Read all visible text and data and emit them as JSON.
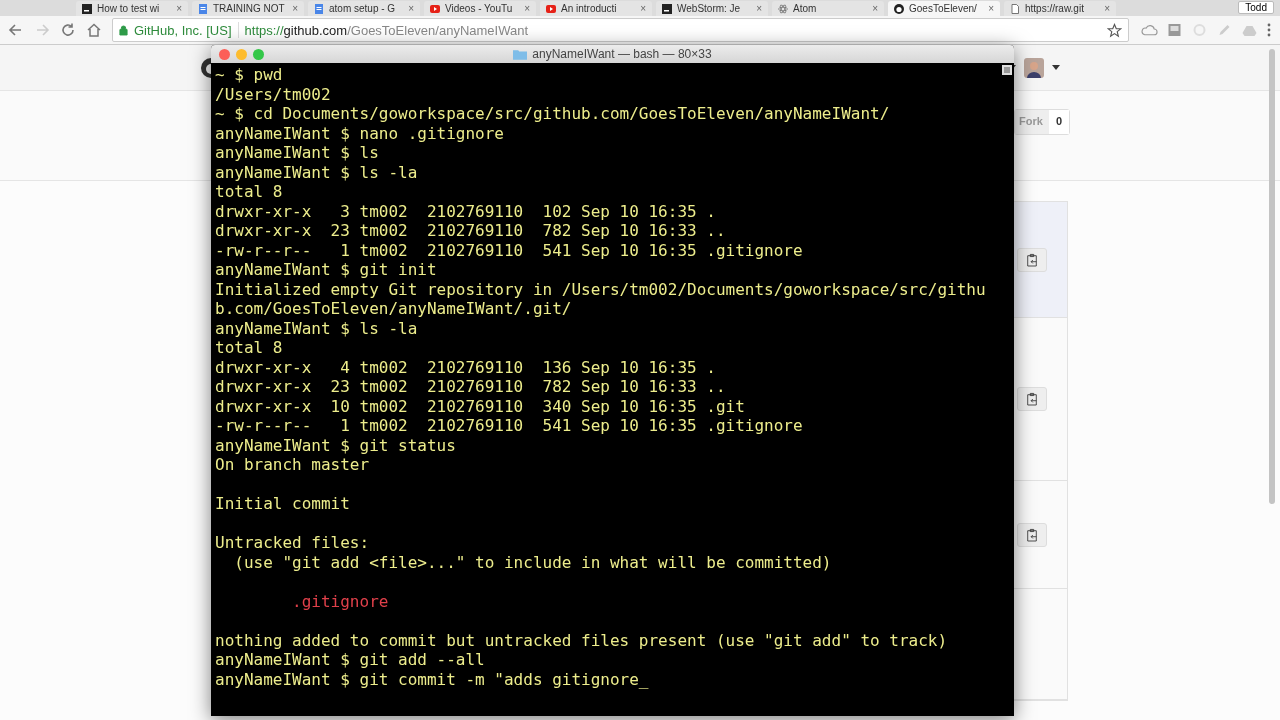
{
  "browser": {
    "tabs": [
      {
        "title": "How to test wi",
        "kind": "logo",
        "close": "×",
        "selected": false
      },
      {
        "title": "TRAINING NOT",
        "kind": "doc",
        "close": "×",
        "selected": false
      },
      {
        "title": "atom setup - G",
        "kind": "doc",
        "close": "×",
        "selected": false
      },
      {
        "title": "Videos - YouTu",
        "kind": "video",
        "close": "×",
        "selected": false
      },
      {
        "title": "An introducti",
        "kind": "video",
        "close": "×",
        "selected": false
      },
      {
        "title": "WebStorm: Je",
        "kind": "logo",
        "close": "×",
        "selected": false
      },
      {
        "title": "Atom",
        "kind": "atom",
        "close": "×",
        "selected": false
      },
      {
        "title": "GoesToEleven/",
        "kind": "github",
        "close": "×",
        "selected": true
      },
      {
        "title": "https://raw.git",
        "kind": "page",
        "close": "×",
        "selected": false
      }
    ],
    "profile": "Todd",
    "address": {
      "site": "GitHub, Inc. [US]",
      "scheme": "https://",
      "host": "github.com",
      "path": "/GoesToEleven/anyNameIWant"
    }
  },
  "github": {
    "fork_label": "Fork",
    "fork_count": "0"
  },
  "terminal": {
    "title": "anyNameIWant — bash — 80×33",
    "lines": [
      {
        "kind": "out",
        "text": "~ $ pwd"
      },
      {
        "kind": "out",
        "text": "/Users/tm002"
      },
      {
        "kind": "out",
        "text": "~ $ cd Documents/goworkspace/src/github.com/GoesToEleven/anyNameIWant/"
      },
      {
        "kind": "out",
        "text": "anyNameIWant $ nano .gitignore"
      },
      {
        "kind": "out",
        "text": "anyNameIWant $ ls"
      },
      {
        "kind": "out",
        "text": "anyNameIWant $ ls -la"
      },
      {
        "kind": "out",
        "text": "total 8"
      },
      {
        "kind": "out",
        "text": "drwxr-xr-x   3 tm002  2102769110  102 Sep 10 16:35 ."
      },
      {
        "kind": "out",
        "text": "drwxr-xr-x  23 tm002  2102769110  782 Sep 10 16:33 .."
      },
      {
        "kind": "out",
        "text": "-rw-r--r--   1 tm002  2102769110  541 Sep 10 16:35 .gitignore"
      },
      {
        "kind": "out",
        "text": "anyNameIWant $ git init"
      },
      {
        "kind": "out",
        "text": "Initialized empty Git repository in /Users/tm002/Documents/goworkspace/src/githu"
      },
      {
        "kind": "out",
        "text": "b.com/GoesToEleven/anyNameIWant/.git/"
      },
      {
        "kind": "out",
        "text": "anyNameIWant $ ls -la"
      },
      {
        "kind": "out",
        "text": "total 8"
      },
      {
        "kind": "out",
        "text": "drwxr-xr-x   4 tm002  2102769110  136 Sep 10 16:35 ."
      },
      {
        "kind": "out",
        "text": "drwxr-xr-x  23 tm002  2102769110  782 Sep 10 16:33 .."
      },
      {
        "kind": "out",
        "text": "drwxr-xr-x  10 tm002  2102769110  340 Sep 10 16:35 .git"
      },
      {
        "kind": "out",
        "text": "-rw-r--r--   1 tm002  2102769110  541 Sep 10 16:35 .gitignore"
      },
      {
        "kind": "out",
        "text": "anyNameIWant $ git status"
      },
      {
        "kind": "out",
        "text": "On branch master"
      },
      {
        "kind": "blank"
      },
      {
        "kind": "out",
        "text": "Initial commit"
      },
      {
        "kind": "blank"
      },
      {
        "kind": "out",
        "text": "Untracked files:"
      },
      {
        "kind": "out",
        "text": "  (use \"git add <file>...\" to include in what will be committed)"
      },
      {
        "kind": "blank"
      },
      {
        "kind": "untracked",
        "text": "        .gitignore"
      },
      {
        "kind": "blank"
      },
      {
        "kind": "out",
        "text": "nothing added to commit but untracked files present (use \"git add\" to track)"
      },
      {
        "kind": "out",
        "text": "anyNameIWant $ git add --all"
      },
      {
        "kind": "out",
        "text": "anyNameIWant $ git commit -m \"adds gitignore_"
      }
    ]
  }
}
